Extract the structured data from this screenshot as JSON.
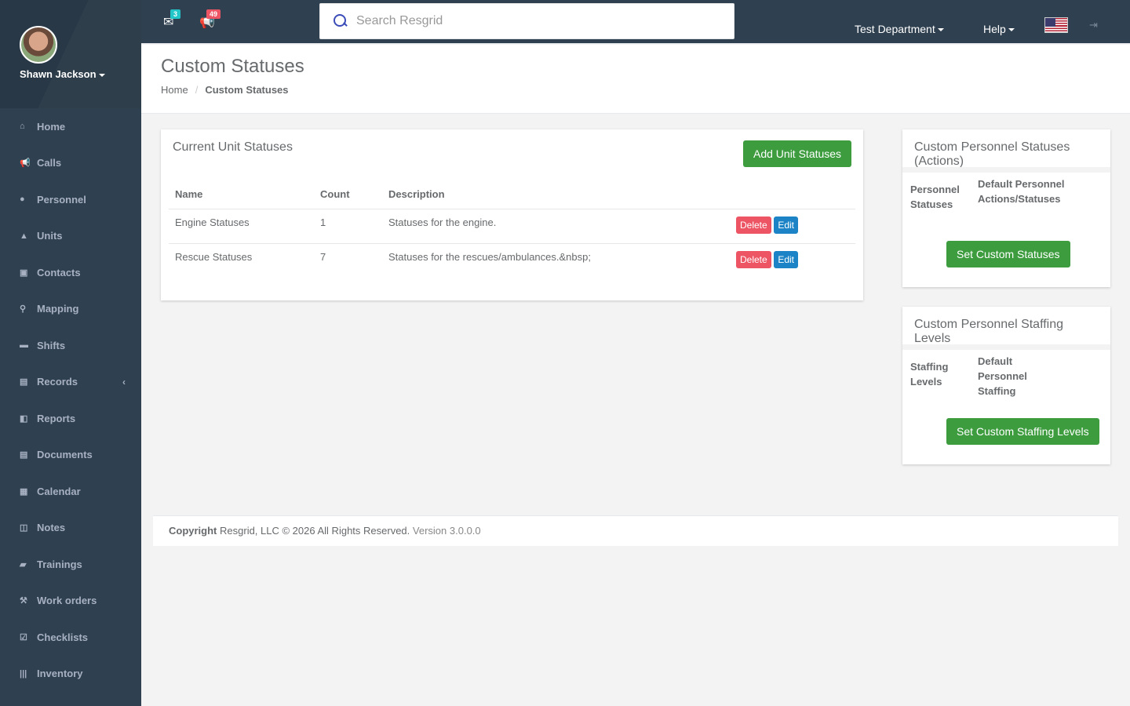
{
  "user": {
    "name": "Shawn Jackson"
  },
  "sidebar": {
    "items": [
      {
        "label": "Home",
        "icon": "⌂"
      },
      {
        "label": "Calls",
        "icon": "📢"
      },
      {
        "label": "Personnel",
        "icon": "●"
      },
      {
        "label": "Units",
        "icon": "▲"
      },
      {
        "label": "Contacts",
        "icon": "▣"
      },
      {
        "label": "Mapping",
        "icon": "⚲"
      },
      {
        "label": "Shifts",
        "icon": "▬"
      },
      {
        "label": "Records",
        "icon": "▤",
        "arrow": "‹"
      },
      {
        "label": "Reports",
        "icon": "◧"
      },
      {
        "label": "Documents",
        "icon": "▤"
      },
      {
        "label": "Calendar",
        "icon": "▦"
      },
      {
        "label": "Notes",
        "icon": "◫"
      },
      {
        "label": "Trainings",
        "icon": "▰"
      },
      {
        "label": "Work orders",
        "icon": "⚒"
      },
      {
        "label": "Checklists",
        "icon": "☑"
      },
      {
        "label": "Inventory",
        "icon": "|||"
      }
    ]
  },
  "topbar": {
    "messages_count": "3",
    "notifications_count": "49",
    "search_placeholder": "Search Resgrid",
    "department_label": "Test Department",
    "help_label": "Help"
  },
  "heading": {
    "title": "Custom Statuses",
    "breadcrumb_home": "Home",
    "breadcrumb_current": "Custom Statuses"
  },
  "unit_statuses": {
    "title": "Current Unit Statuses",
    "add_button": "Add Unit Statuses",
    "columns": [
      "Name",
      "Count",
      "Description"
    ],
    "rows": [
      {
        "name": "Engine Statuses",
        "count": "1",
        "description": "Statuses for the engine.",
        "delete": "Delete",
        "edit": "Edit"
      },
      {
        "name": "Rescue Statuses",
        "count": "7",
        "description": "Statuses for the rescues/ambulances.&nbsp;",
        "delete": "Delete",
        "edit": "Edit"
      }
    ]
  },
  "personnel_statuses": {
    "title": "Custom Personnel Statuses (Actions)",
    "label": "Personnel Statuses",
    "value": "Default Personnel Actions/Statuses",
    "button": "Set Custom Statuses"
  },
  "staffing_levels": {
    "title": "Custom Personnel Staffing Levels",
    "label": "Staffing Levels",
    "value": "Default Personnel Staffing",
    "button": "Set Custom Staffing Levels"
  },
  "footer": {
    "copyright_bold": "Copyright",
    "copyright_text": "Resgrid, LLC © 2026 All Rights Reserved.",
    "version": "Version 3.0.0.0"
  }
}
